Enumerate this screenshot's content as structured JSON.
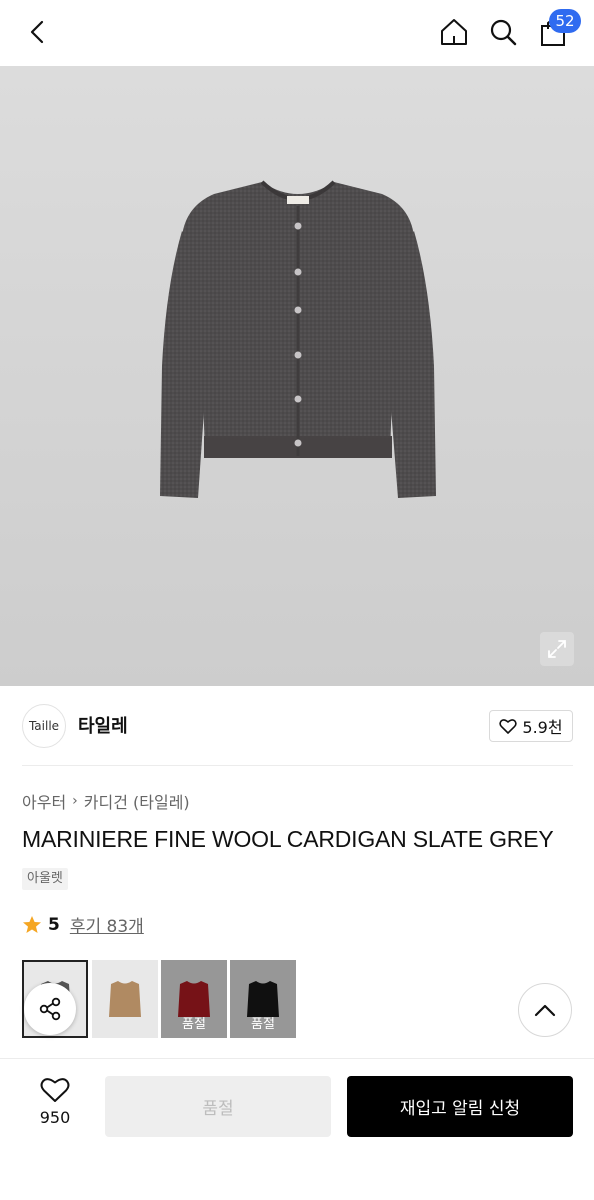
{
  "header": {
    "cart_count": "52",
    "icons": [
      "back-arrow-icon",
      "home-icon",
      "search-icon",
      "shopping-bag-icon"
    ]
  },
  "product": {
    "image": "grey-cardigan",
    "brand_logo_text": "Taille",
    "brand_name": "타일레",
    "likes": "5.9천",
    "breadcrumb": [
      "아우터",
      "카디건 (타일레)"
    ],
    "title": "MARINIERE FINE WOOL CARDIGAN SLATE GREY",
    "tag": "아울렛",
    "rating": "5",
    "reviews": "후기 83개"
  },
  "colors": [
    {
      "name": "slate-grey",
      "color": "#555555",
      "selected": true,
      "sold_out_label": ""
    },
    {
      "name": "camel",
      "color": "#b08a62",
      "selected": false,
      "sold_out_label": ""
    },
    {
      "name": "red",
      "color": "#b51c24",
      "selected": false,
      "sold_out_label": "품절"
    },
    {
      "name": "black",
      "color": "#1a1a1a",
      "selected": false,
      "sold_out_label": "품절"
    }
  ],
  "bottom_bar": {
    "wish_count": "950",
    "soldout_label": "품절",
    "notify_label": "재입고 알림 신청"
  },
  "theme": {
    "accent": "#2f6bf0",
    "star": "#f5a623",
    "primary_button": "#000000"
  }
}
